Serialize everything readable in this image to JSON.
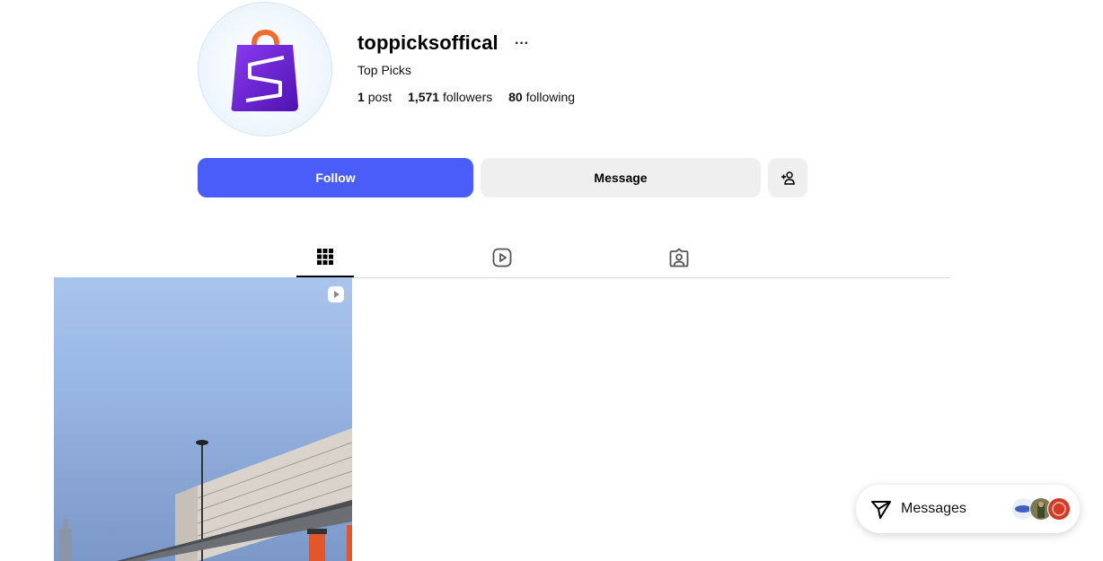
{
  "profile": {
    "username": "toppicksoffical",
    "more_label": "···",
    "full_name": "Top Picks",
    "posts_count": "1",
    "posts_label": "post",
    "followers_count": "1,571",
    "followers_label": "followers",
    "following_count": "80",
    "following_label": "following",
    "avatar_icon": "shopping-bag-logo-icon"
  },
  "actions": {
    "follow_label": "Follow",
    "message_label": "Message",
    "add_user_icon": "person-add-icon"
  },
  "tabs": [
    {
      "name": "posts",
      "icon": "grid-icon",
      "active": true
    },
    {
      "name": "reels",
      "icon": "reels-icon",
      "active": false
    },
    {
      "name": "tagged",
      "icon": "tagged-icon",
      "active": false
    }
  ],
  "posts": [
    {
      "type": "reel",
      "icon": "reel-badge-icon"
    }
  ],
  "messages": {
    "label": "Messages",
    "icon": "paper-plane-icon"
  },
  "colors": {
    "follow_button": "#4a5df9",
    "secondary_button": "#efefef",
    "logo_purple": "#6b1fd1",
    "logo_handle": "#f06b2c"
  }
}
